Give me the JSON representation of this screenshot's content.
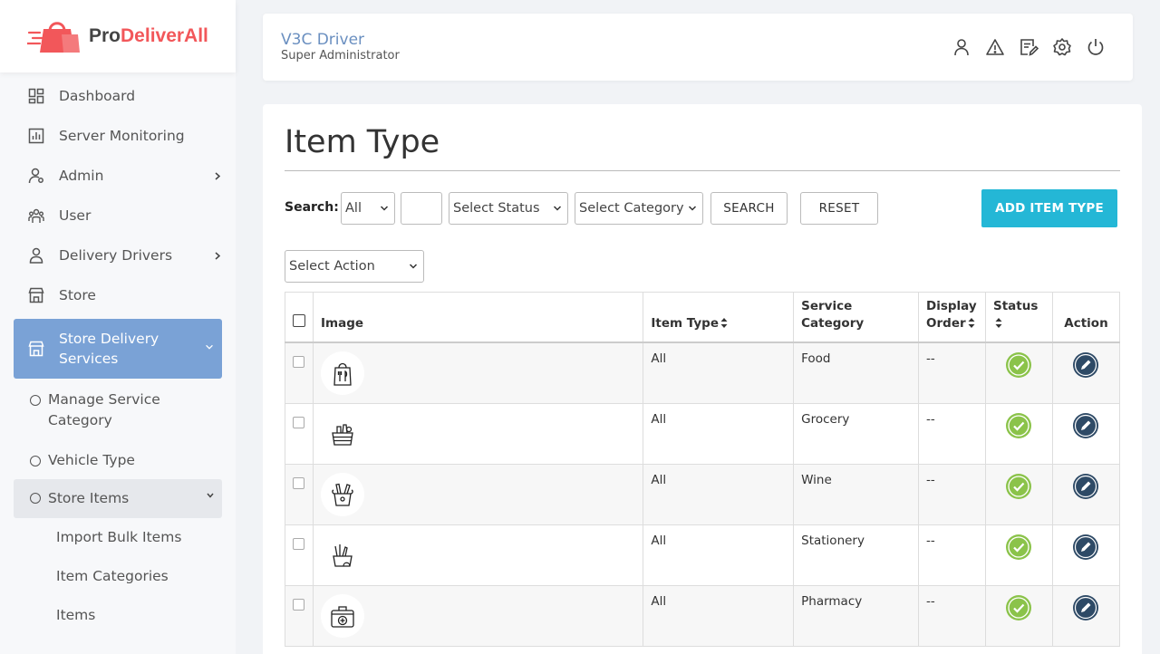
{
  "brand": {
    "pro": "Pro",
    "rest": "DeliverAll",
    "accent": "#f2575a"
  },
  "header": {
    "user_name": "V3C Driver",
    "user_role": "Super Administrator",
    "icons": [
      "user-icon",
      "alert-icon",
      "notes-icon",
      "settings-icon",
      "power-icon"
    ]
  },
  "sidebar": {
    "items": [
      {
        "label": "Dashboard",
        "icon": "dashboard-icon"
      },
      {
        "label": "Server Monitoring",
        "icon": "monitor-icon"
      },
      {
        "label": "Admin",
        "icon": "admin-icon"
      },
      {
        "label": "User",
        "icon": "users-icon"
      },
      {
        "label": "Delivery Drivers",
        "icon": "driver-icon"
      },
      {
        "label": "Store",
        "icon": "store-icon"
      },
      {
        "label": "Store Delivery Services",
        "icon": "store-icon"
      }
    ],
    "sub_items": [
      {
        "label": "Manage Service Category"
      },
      {
        "label": "Vehicle Type"
      },
      {
        "label": "Store Items"
      }
    ],
    "leaf_items": [
      {
        "label": "Import Bulk Items"
      },
      {
        "label": "Item Categories"
      },
      {
        "label": "Items"
      }
    ],
    "active_color": "#7aa2d6"
  },
  "page": {
    "title": "Item Type",
    "search_label": "Search:",
    "filter_all": "All",
    "status_placeholder": "Select Status",
    "category_placeholder": "Select Category",
    "search_button": "SEARCH",
    "reset_button": "RESET",
    "add_button": "ADD ITEM TYPE",
    "action_placeholder": "Select Action",
    "add_button_color": "#24b7d6"
  },
  "table": {
    "headers": {
      "image": "Image",
      "item_type": "Item Type",
      "service_category": "Service Category",
      "display_order_1": "Display",
      "display_order_2": "Order",
      "status": "Status",
      "action": "Action"
    },
    "rows": [
      {
        "icon": "food-bag-icon",
        "item_type": "All",
        "service_category": "Food",
        "display_order": "--"
      },
      {
        "icon": "grocery-basket-icon",
        "item_type": "All",
        "service_category": "Grocery",
        "display_order": "--"
      },
      {
        "icon": "wine-bucket-icon",
        "item_type": "All",
        "service_category": "Wine",
        "display_order": "--"
      },
      {
        "icon": "stationery-basket-icon",
        "item_type": "All",
        "service_category": "Stationery",
        "display_order": "--"
      },
      {
        "icon": "pharmacy-kit-icon",
        "item_type": "All",
        "service_category": "Pharmacy",
        "display_order": "--"
      }
    ],
    "status_color": "#8bc34a",
    "edit_color": "#2e4a66"
  }
}
